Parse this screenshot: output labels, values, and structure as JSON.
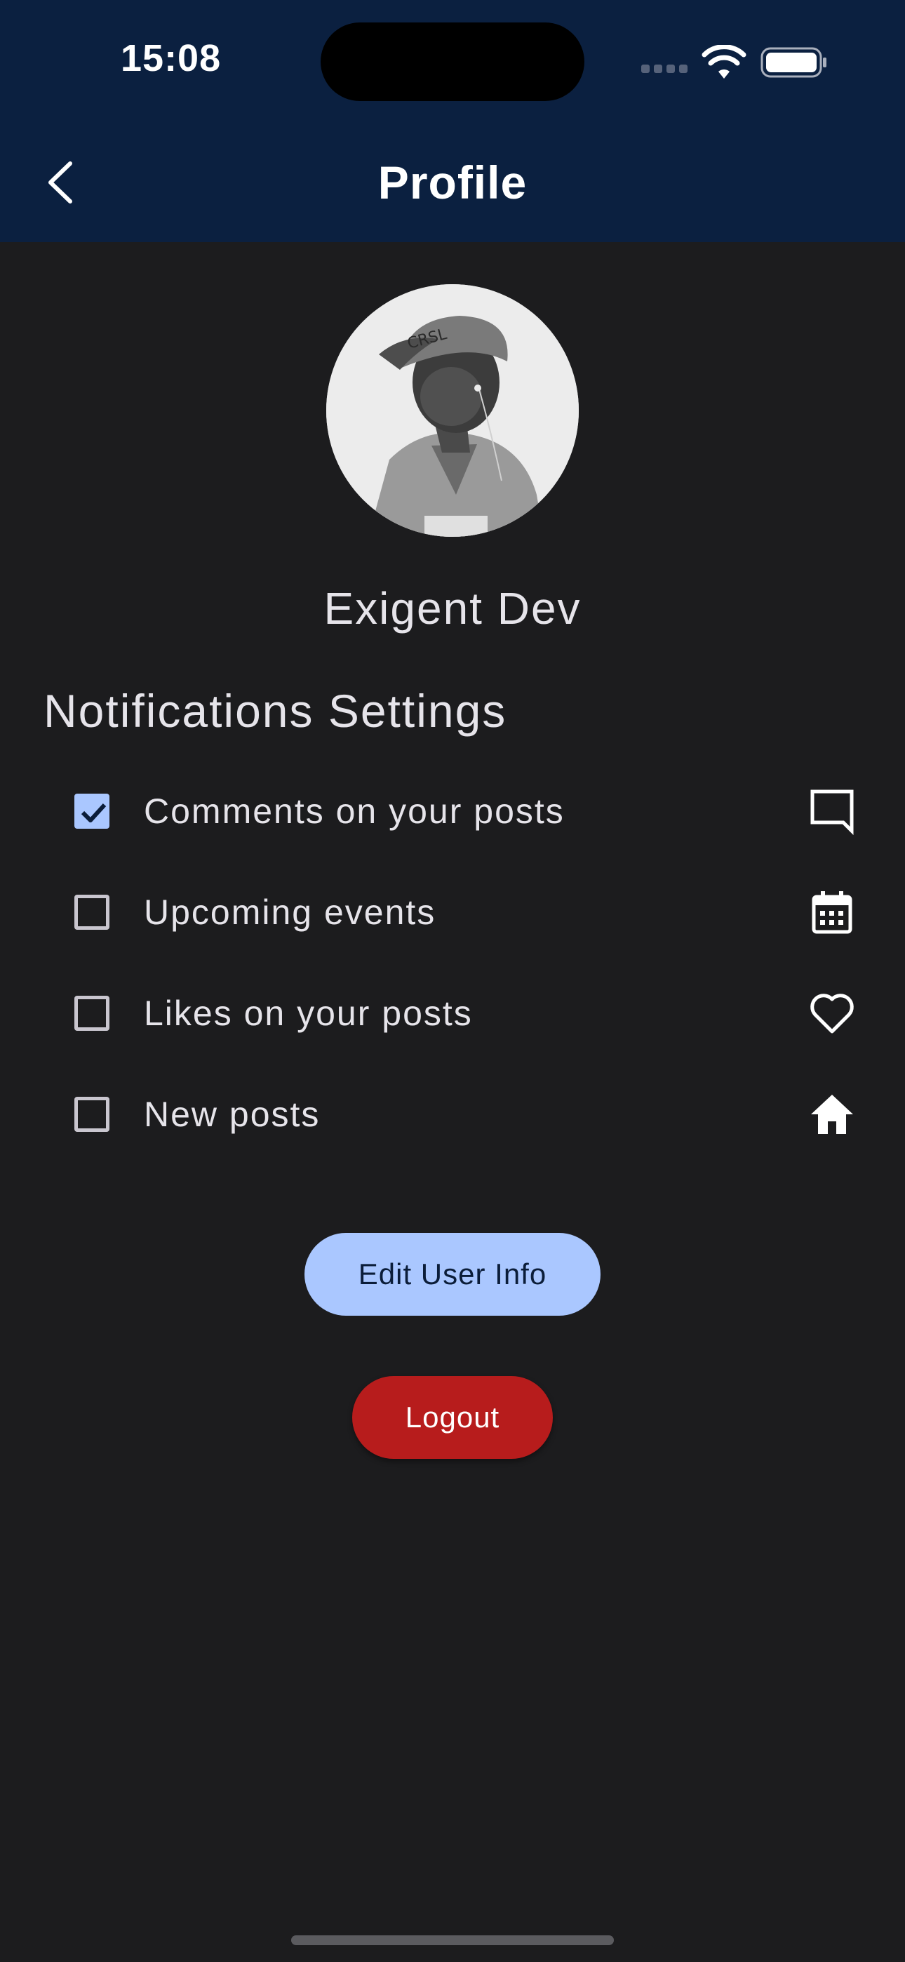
{
  "status_bar": {
    "time": "15:08"
  },
  "header": {
    "title": "Profile",
    "back_icon": "chevron-left-icon",
    "background_color": "#0b2040"
  },
  "profile": {
    "name": "Exigent Dev",
    "avatar_icon": "user-avatar-photo"
  },
  "notifications": {
    "section_title": "Notifications Settings",
    "items": [
      {
        "label": "Comments on your posts",
        "checked": true,
        "icon": "comment-icon"
      },
      {
        "label": "Upcoming events",
        "checked": false,
        "icon": "calendar-icon"
      },
      {
        "label": "Likes on your posts",
        "checked": false,
        "icon": "heart-icon"
      },
      {
        "label": "New posts",
        "checked": false,
        "icon": "home-icon"
      }
    ]
  },
  "actions": {
    "edit_label": "Edit User Info",
    "logout_label": "Logout"
  },
  "colors": {
    "accent": "#aac7ff",
    "danger": "#b71c1c",
    "background": "#1c1c1e"
  }
}
